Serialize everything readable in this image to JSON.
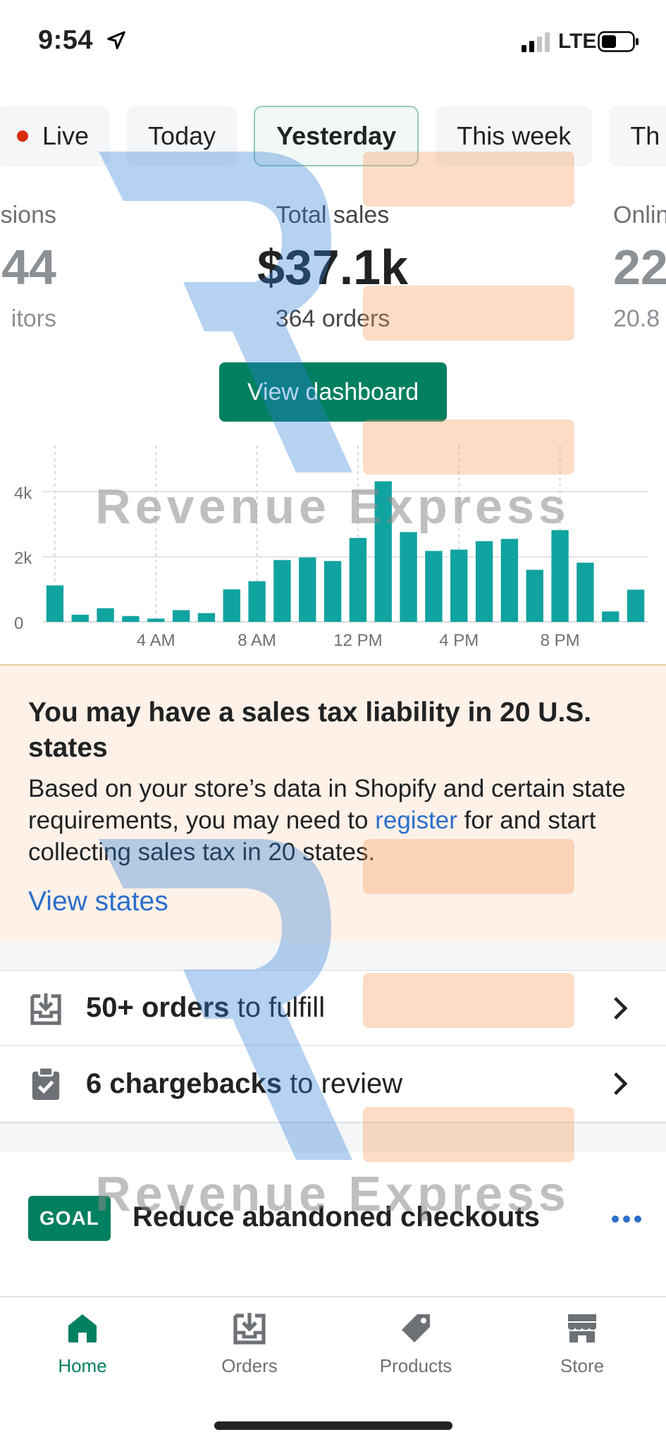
{
  "status_bar": {
    "time": "9:54",
    "network": "LTE"
  },
  "tabs": [
    {
      "label": "Live"
    },
    {
      "label": "Today"
    },
    {
      "label": "Yesterday"
    },
    {
      "label": "This week"
    },
    {
      "label": "Th"
    }
  ],
  "metrics": {
    "left": {
      "label": "sions",
      "value": "44",
      "sub": "itors"
    },
    "center": {
      "label": "Total sales",
      "value": "$37.1k",
      "sub": "364 orders"
    },
    "right": {
      "label": "Onlin",
      "value": "22",
      "sub": "20.8"
    }
  },
  "view_dashboard_label": "View dashboard",
  "chart_data": {
    "type": "bar",
    "categories": [
      "12 AM",
      "1 AM",
      "2 AM",
      "3 AM",
      "4 AM",
      "5 AM",
      "6 AM",
      "7 AM",
      "8 AM",
      "9 AM",
      "10 AM",
      "11 AM",
      "12 PM",
      "1 PM",
      "2 PM",
      "3 PM",
      "4 PM",
      "5 PM",
      "6 PM",
      "7 PM",
      "8 PM",
      "9 PM",
      "10 PM",
      "11 PM"
    ],
    "values": [
      1120,
      220,
      420,
      180,
      100,
      360,
      270,
      1000,
      1250,
      1900,
      1980,
      1870,
      2580,
      4320,
      2760,
      2180,
      2220,
      2480,
      2550,
      1600,
      2820,
      1820,
      320,
      990
    ],
    "x_tick_labels": [
      "4 AM",
      "8 AM",
      "12 PM",
      "4 PM",
      "8 PM"
    ],
    "y_tick_labels": [
      "0",
      "2k",
      "4k"
    ],
    "ylim": [
      0,
      5200
    ],
    "color": "#11a3a0"
  },
  "banner": {
    "title": "You may have a sales tax liability in 20 U.S. states",
    "body_before": "Based on your store’s data in Shopify and certain state requirements, you may need to ",
    "body_link": "register",
    "body_after": " for and start collecting sales tax in 20 states.",
    "link": "View states"
  },
  "tasks": [
    {
      "bold": "50+ orders",
      "rest": " to fulfill"
    },
    {
      "bold": "6 chargebacks",
      "rest": " to review"
    }
  ],
  "goal": {
    "badge": "GOAL",
    "text": "Reduce abandoned checkouts"
  },
  "bottom_nav": {
    "home": "Home",
    "orders": "Orders",
    "products": "Products",
    "store": "Store"
  },
  "watermark": {
    "text": "Revenue Express"
  },
  "colors": {
    "primary": "#008060",
    "link": "#2c6ecb",
    "live": "#d82c0d",
    "banner_bg": "#fdf1e8"
  }
}
